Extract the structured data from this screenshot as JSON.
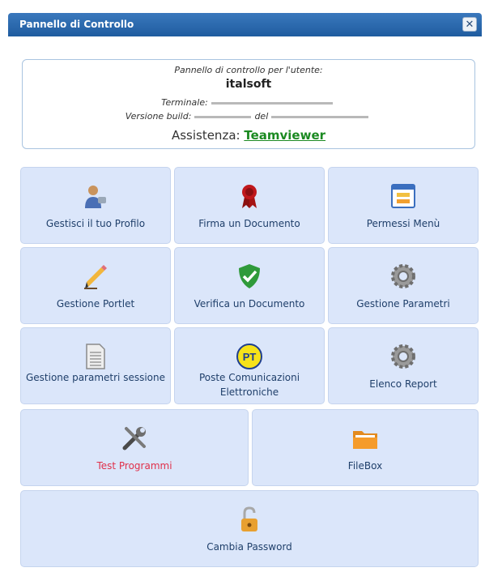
{
  "window": {
    "title": "Pannello di Controllo",
    "close_icon": "close-icon"
  },
  "info": {
    "intro": "Pannello di controllo per l'utente:",
    "user": "italsoft",
    "terminal_label": "Terminale:",
    "build_label": "Versione build:",
    "build_date_label": "del",
    "support_label": "Assistenza:",
    "support_link": "Teamviewer"
  },
  "tiles": [
    {
      "label": "Gestisci il tuo Profilo",
      "icon": "user-profile-icon"
    },
    {
      "label": "Firma un Documento",
      "icon": "seal-ribbon-icon"
    },
    {
      "label": "Permessi Menù",
      "icon": "menu-permissions-icon"
    },
    {
      "label": "Gestione Portlet",
      "icon": "pencil-icon"
    },
    {
      "label": "Verifica un Documento",
      "icon": "shield-check-icon"
    },
    {
      "label": "Gestione Parametri",
      "icon": "gear-icon"
    },
    {
      "label": "Gestione parametri sessione",
      "icon": "document-icon"
    },
    {
      "label": "Poste Comunicazioni Elettroniche",
      "icon": "pt-logo-icon",
      "icon_text": "PT"
    },
    {
      "label": "Elenco Report",
      "icon": "gear-icon"
    },
    {
      "label": "Test Programmi",
      "icon": "tools-icon"
    },
    {
      "label": "FileBox",
      "icon": "folder-icon"
    },
    {
      "label": "Cambia Password",
      "icon": "unlock-icon"
    }
  ],
  "colors": {
    "titlebar": "#2866a8",
    "tile_bg": "#dbe6fa",
    "link_green": "#1c8a22",
    "label_red": "#e0304a"
  }
}
